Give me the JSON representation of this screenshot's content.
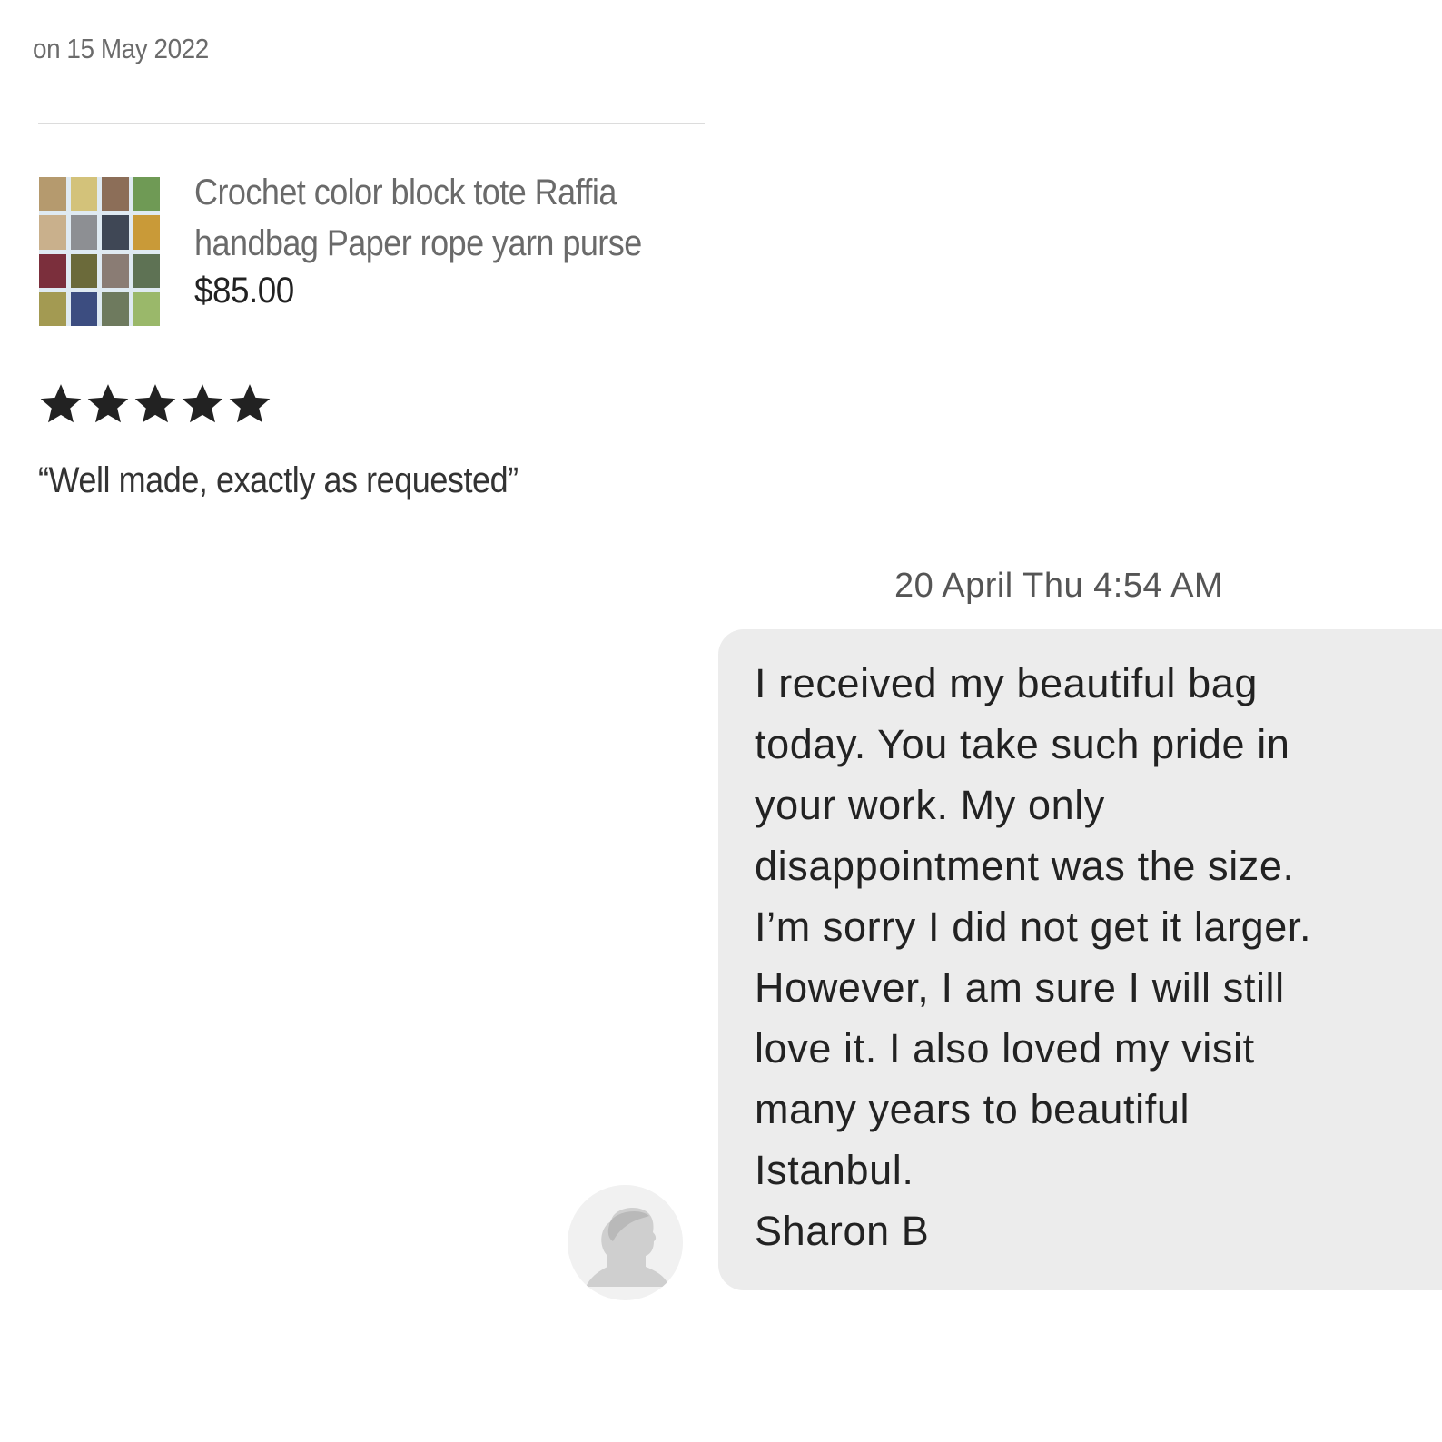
{
  "review": {
    "date": "on 15 May 2022",
    "product": {
      "title_line1": "Crochet color block tote Raffia",
      "title_line2": "handbag Paper rope yarn purse",
      "price": "$85.00",
      "thumbnail_icon": "yarn-swatches-thumbnail"
    },
    "rating": 5,
    "rating_max": 5,
    "star_color": "#222222",
    "quote": "“Well made, exactly as requested”"
  },
  "message": {
    "timestamp": "20 April Thu 4:54 AM",
    "lines": [
      "I received my beautiful bag",
      "today. You take such pride in",
      "your work. My only",
      "disappointment was the size.",
      "I’m sorry I did not get it larger.",
      "However, I am sure I will still",
      "love it. I also loved my visit",
      "many years to beautiful",
      "Istanbul.",
      "Sharon B"
    ],
    "bubble_color": "#ececec",
    "avatar_icon": "default-user-avatar-icon"
  }
}
